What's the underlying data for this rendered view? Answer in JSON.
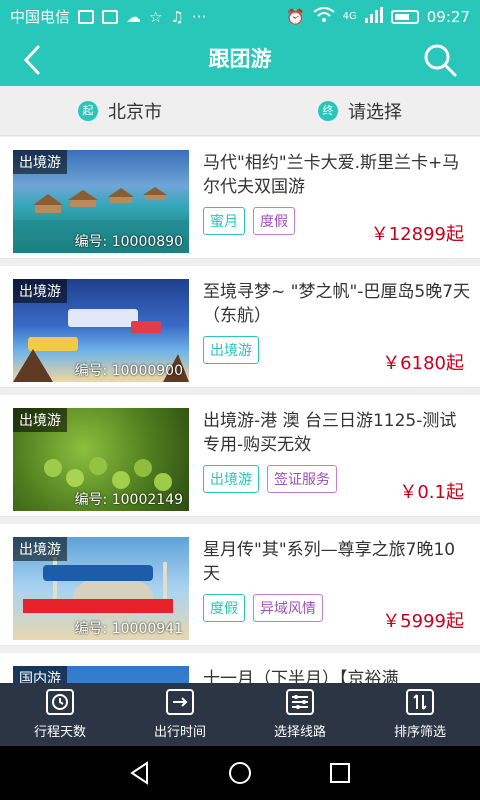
{
  "status": {
    "carrier": "中国电信",
    "time": "09:27",
    "network": "4G"
  },
  "appbar": {
    "title": "跟团游"
  },
  "route": {
    "start_badge": "起",
    "start_city": "北京市",
    "end_badge": "终",
    "end_placeholder": "请选择"
  },
  "items": [
    {
      "category": "出境游",
      "code": "编号: 10000890",
      "name": "马代\"相约\"兰卡大爱.斯里兰卡+马尔代夫双国游",
      "tags": [
        {
          "label": "蜜月",
          "style": "teal"
        },
        {
          "label": "度假",
          "style": "purple"
        }
      ],
      "price": "￥12899起"
    },
    {
      "category": "出境游",
      "code": "编号: 10000900",
      "name": "至境寻梦~ \"梦之帆\"-巴厘岛5晚7天（东航）",
      "tags": [
        {
          "label": "出境游",
          "style": "teal"
        }
      ],
      "price": "￥6180起"
    },
    {
      "category": "出境游",
      "code": "编号: 10002149",
      "name": "出境游-港 澳 台三日游1125-测试专用-购买无效",
      "tags": [
        {
          "label": "出境游",
          "style": "teal"
        },
        {
          "label": "签证服务",
          "style": "purple"
        }
      ],
      "price": "￥0.1起"
    },
    {
      "category": "出境游",
      "code": "编号: 10000941",
      "name": "星月传\"其\"系列—尊享之旅7晚10天",
      "tags": [
        {
          "label": "度假",
          "style": "teal"
        },
        {
          "label": "异域风情",
          "style": "purple"
        }
      ],
      "price": "￥5999起"
    },
    {
      "category": "国内游",
      "code": "",
      "name": "十一月（下半月）【京裕满",
      "tags": [],
      "price": ""
    }
  ],
  "bottomnav": {
    "days": "行程天数",
    "time": "出行时间",
    "route": "选择线路",
    "sort": "排序筛选"
  },
  "colors": {
    "accent": "#29c6ba",
    "price": "#c9001d",
    "nav_bg": "#2c3544"
  }
}
